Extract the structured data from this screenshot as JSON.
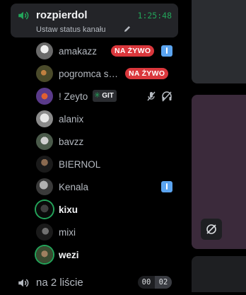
{
  "active_channel": {
    "name": "rozpierdol",
    "timer": "1:25:48",
    "status_placeholder": "Ustaw status kanału"
  },
  "members": [
    {
      "name": "amakazz",
      "live_label": "NA ŻYWO",
      "avatar_color": "#d8d8d8"
    },
    {
      "name": "pogromca s…",
      "live_label": "NA ŻYWO",
      "avatar_color": "#5a5a3a"
    },
    {
      "name": "! Zeyto",
      "tag_label": "GIT",
      "tag_icon": "leaf-icon",
      "avatar_color": "#6a4a8a"
    },
    {
      "name": "alanix",
      "avatar_color": "#cfcfcf"
    },
    {
      "name": "bavzz",
      "avatar_color": "#9aa09a"
    },
    {
      "name": "BIERNOL",
      "avatar_color": "#4a3a30"
    },
    {
      "name": "Kenala",
      "avatar_color": "#6a6a6a"
    },
    {
      "name": "kixu",
      "avatar_color": "#101010"
    },
    {
      "name": "mixi",
      "avatar_color": "#3a3a3a"
    },
    {
      "name": "wezi",
      "avatar_color": "#4a5a40"
    }
  ],
  "second_channel": {
    "name": "na 2 liście",
    "count_left": "00",
    "count_right": "02"
  },
  "colors": {
    "accent_green": "#23a55a",
    "live_red": "#da373c",
    "phone_blue": "#5ba4f0",
    "tile_purple": "#3b2a3b"
  }
}
